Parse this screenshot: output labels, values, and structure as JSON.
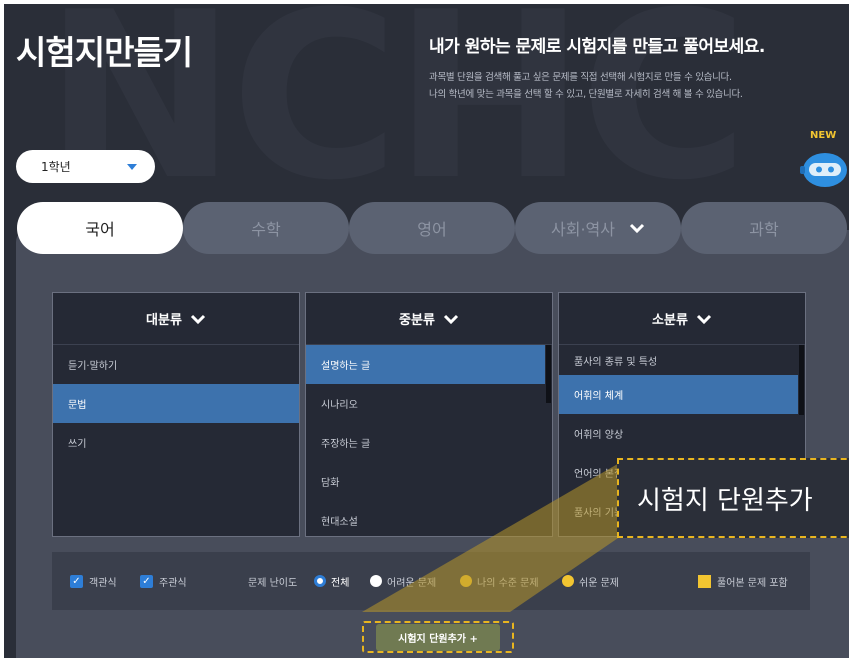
{
  "header": {
    "watermark": "NCHC",
    "title": "시험지만들기",
    "headline": "내가 원하는 문제로 시험지를 만들고 풀어보세요.",
    "desc_line1": "과목별 단원을 검색해 풀고 싶은 문제를 직접 선택해 시험지로 만들 수 있습니다.",
    "desc_line2": "나의 학년에 맞는 과목을 선택 할 수 있고, 단원별로 자세히 검색 해 볼 수 있습니다."
  },
  "grade_select": {
    "value": "1학년"
  },
  "new_badge": "NEW",
  "tabs": [
    {
      "label": "국어",
      "active": true
    },
    {
      "label": "수학",
      "active": false
    },
    {
      "label": "영어",
      "active": false
    },
    {
      "label": "사회·역사",
      "active": false,
      "has_chevron": true
    },
    {
      "label": "과학",
      "active": false
    }
  ],
  "columns": {
    "major": {
      "header": "대분류",
      "items": [
        "듣기·말하기",
        "문법",
        "쓰기"
      ],
      "selected": 1
    },
    "middle": {
      "header": "중분류",
      "items": [
        "설명하는 글",
        "시나리오",
        "주장하는 글",
        "담화",
        "현대소설"
      ],
      "selected": 0
    },
    "minor": {
      "header": "소분류",
      "items": [
        "품사의 종류 및 특성",
        "어휘의 체계",
        "어휘의 양상",
        "언어의 본질",
        "품사의 기능"
      ],
      "selected": 1
    }
  },
  "filters": {
    "objective_label": "객관식",
    "subjective_label": "주관식",
    "difficulty_label": "문제 난이도",
    "options": [
      {
        "label": "전체",
        "color": "#2e7ed7",
        "selected": true
      },
      {
        "label": "어려운 문제",
        "color": "#ffffff",
        "selected": false
      },
      {
        "label": "나의 수준 문제",
        "color": "#f2c531",
        "selected": false
      },
      {
        "label": "쉬운 문제",
        "color": "#f2c531",
        "selected": false
      }
    ],
    "include_solved_label": "풀어본 문제 포함"
  },
  "add_button_label": "시험지 단원추가 +",
  "callout_text": "시험지 단원추가",
  "colors": {
    "background": "#2a2e38",
    "panel": "#484d5b",
    "accent_blue": "#2e7ed7",
    "selected_row": "#3d72ad",
    "highlight_yellow": "#e8b51f"
  }
}
